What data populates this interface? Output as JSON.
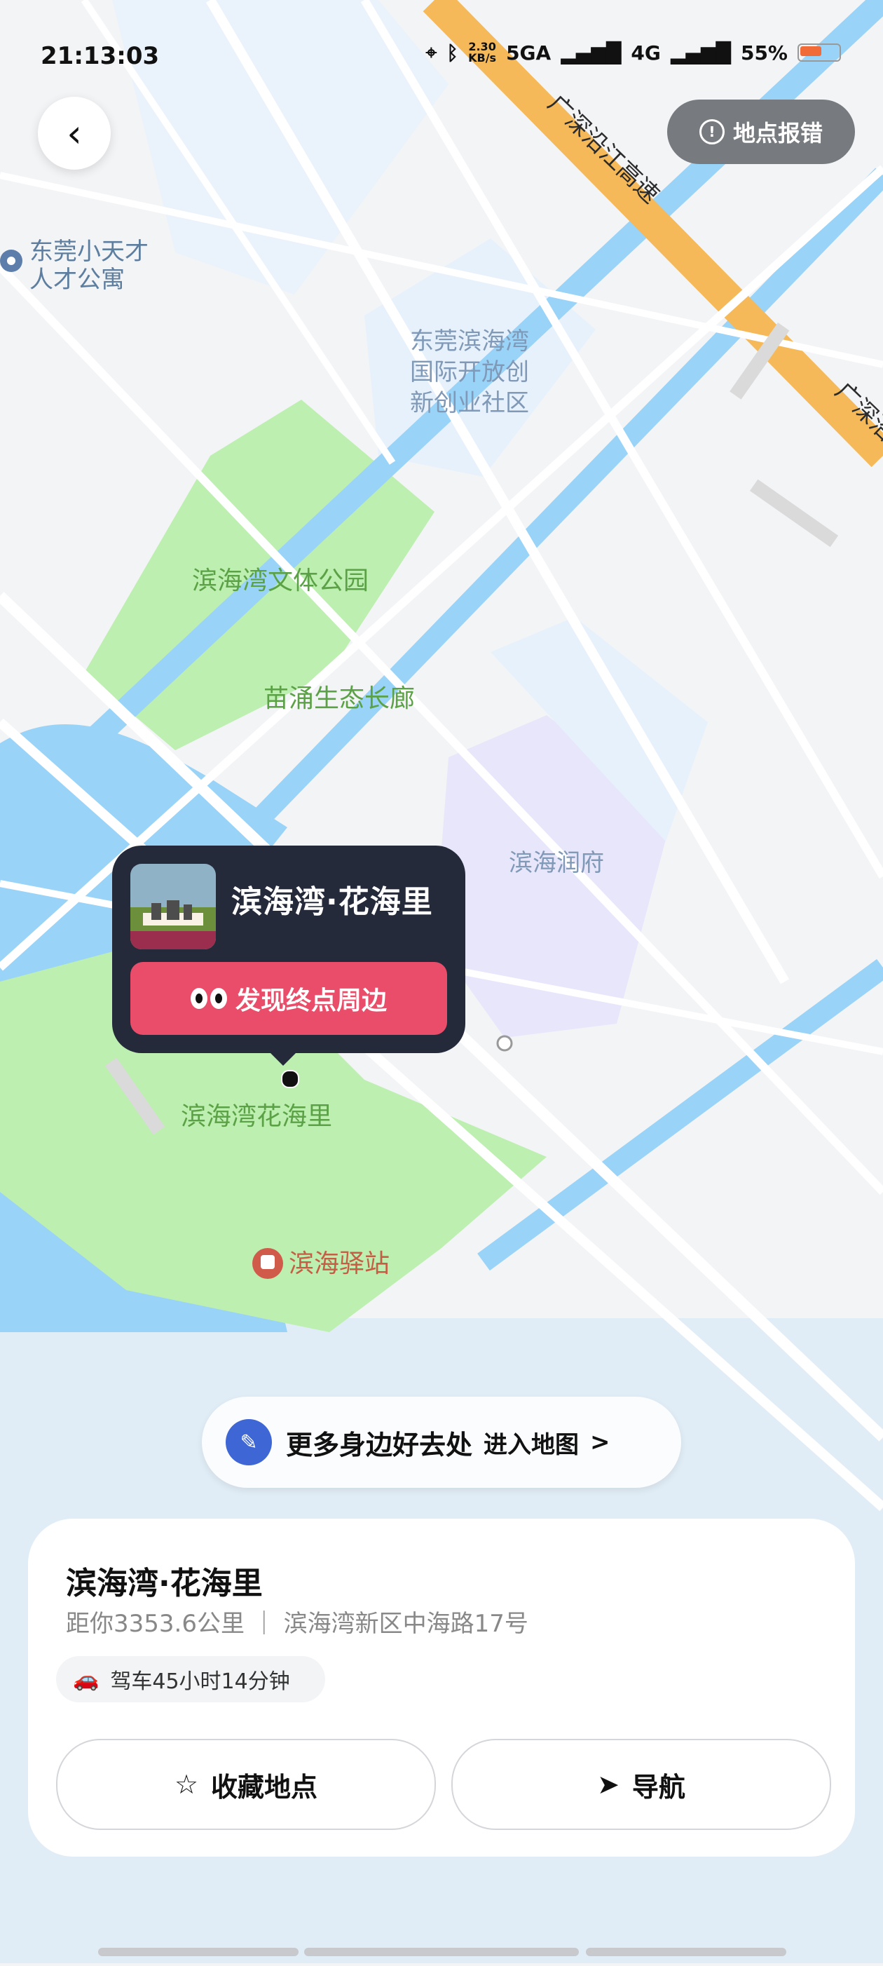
{
  "status_bar": {
    "time": "21:13:03",
    "speed_top": "2.30",
    "speed_bottom": "KB/s",
    "network1": "5GA",
    "network2": "4G",
    "battery": "55%"
  },
  "top_actions": {
    "report_label": "地点报错"
  },
  "map_labels": {
    "road_name_1": "广深沿江高速",
    "road_name_2": "广深沿",
    "poi_1": "东莞小天才人才公寓",
    "poi_1_line1": "东莞小天才",
    "poi_1_line2": "人才公寓",
    "area_1_line1": "东莞滨海湾",
    "area_1_line2": "国际开放创",
    "area_1_line3": "新创业社区",
    "park_1": "滨海湾文体公园",
    "park_2": "苗涌生态长廊",
    "resident": "滨海润府",
    "destination_label": "滨海湾花海里",
    "station": "滨海驿站"
  },
  "callout": {
    "title": "滨海湾·花海里",
    "action": "发现终点周边"
  },
  "explore": {
    "text": "更多身边好去处",
    "subtext": "进入地图",
    "chevron": ">"
  },
  "place": {
    "name": "滨海湾·花海里",
    "meta": "距你3353.6公里 ｜ 滨海湾新区中海路17号",
    "drive": "驾车45小时14分钟",
    "favorite": "收藏地点",
    "navigate": "导航"
  }
}
